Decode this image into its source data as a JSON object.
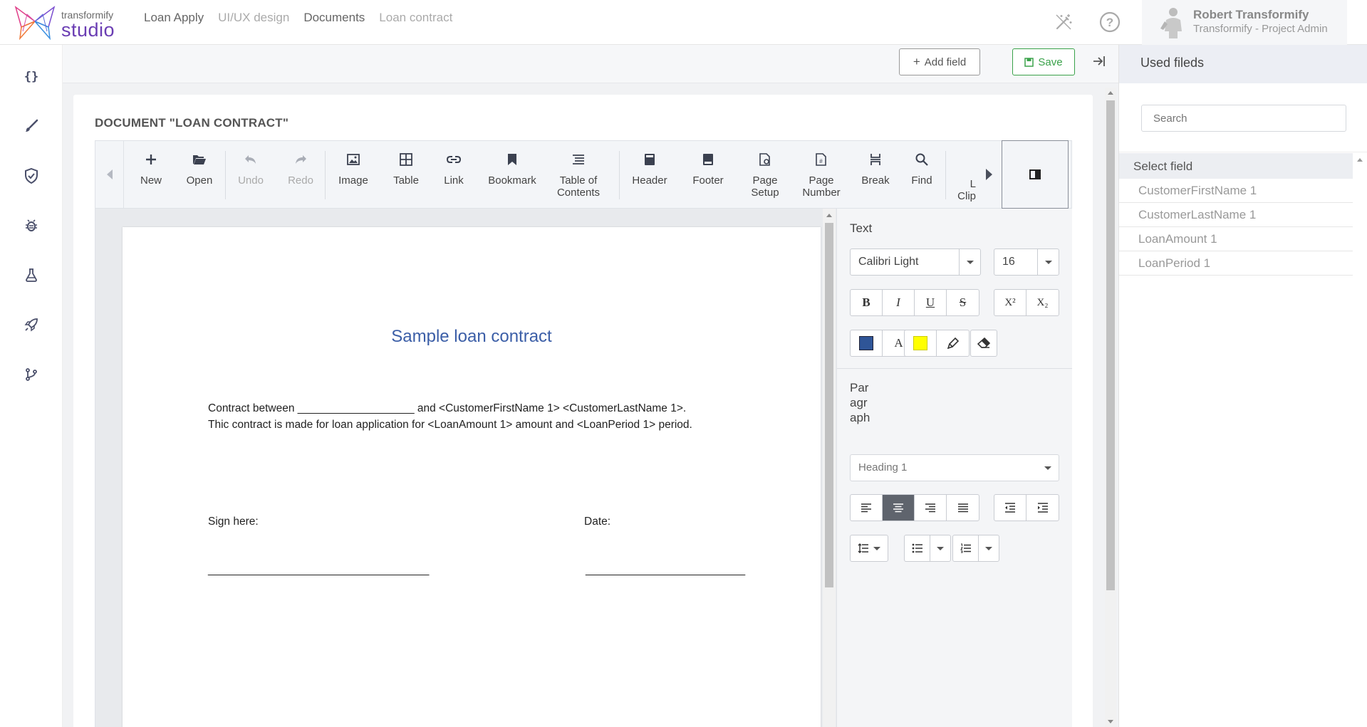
{
  "app": {
    "logo_small": "transformify",
    "logo_big": "studio"
  },
  "breadcrumbs": [
    {
      "label": "Loan Apply"
    },
    {
      "label": "UI/UX design"
    },
    {
      "label": "Documents"
    },
    {
      "label": "Loan contract"
    }
  ],
  "user": {
    "name": "Robert Transformify",
    "role": "Transformify - Project Admin"
  },
  "sidebar": {
    "icons": [
      "code-braces-icon",
      "brush-icon",
      "shield-check-icon",
      "bug-icon",
      "flask-icon",
      "rocket-icon",
      "git-branch-icon"
    ]
  },
  "actions": {
    "add_field": "Add field",
    "save": "Save"
  },
  "document": {
    "title": "DOCUMENT \"LOAN CONTRACT\""
  },
  "ribbon": {
    "items": [
      {
        "label": "New"
      },
      {
        "label": "Open"
      },
      {
        "label": "Undo"
      },
      {
        "label": "Redo"
      },
      {
        "label": "Image"
      },
      {
        "label": "Table"
      },
      {
        "label": "Link"
      },
      {
        "label": "Bookmark"
      },
      {
        "label": "Table of\nContents"
      },
      {
        "label": "Header"
      },
      {
        "label": "Footer"
      },
      {
        "label": "Page\nSetup"
      },
      {
        "label": "Page\nNumber"
      },
      {
        "label": "Break"
      },
      {
        "label": "Find"
      },
      {
        "label": "L\nClip"
      }
    ]
  },
  "doc_content": {
    "heading": "Sample loan contract",
    "line1": "Contract between ___________________ and <CustomerFirstName 1> <CustomerLastName 1>.",
    "line2": "Thic contract is made for loan application for <LoanAmount 1> amount and <LoanPeriod 1> period.",
    "sign_label": "Sign here:",
    "date_label": "Date:",
    "sign_line": "____________________________________",
    "date_line": "__________________________"
  },
  "properties": {
    "text_label": "Text",
    "font_family": "Calibri Light",
    "font_size": "16",
    "paragraph_label": "Par\nagr\naph",
    "style": "Heading 1",
    "font_color": "#2f5597",
    "highlight_color": "#ffff00",
    "format_buttons": {
      "bold": "B",
      "italic": "I",
      "underline": "U",
      "strike": "S",
      "superscript": "X²",
      "subscript": "X₂",
      "font_color_letter": "A"
    }
  },
  "used_fields": {
    "title": "Used fileds",
    "search_placeholder": "Search",
    "select_header": "Select field",
    "items": [
      {
        "label": "CustomerFirstName 1"
      },
      {
        "label": "CustomerLastName 1"
      },
      {
        "label": "LoanAmount 1"
      },
      {
        "label": "LoanPeriod 1"
      }
    ]
  }
}
